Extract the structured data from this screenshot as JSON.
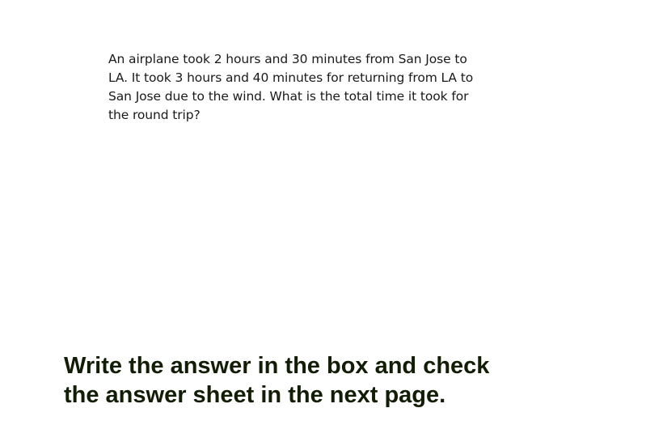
{
  "question": {
    "lines": [
      "An airplane took 2 hours and 30 minutes from  San Jose to",
      "LA. It took 3 hours and 40 minutes for returning from LA to",
      "San Jose due to the wind. What is the total time it took for",
      "the round trip?"
    ]
  },
  "instruction": {
    "lines": [
      "Write the answer in the box and check",
      "the answer sheet in the next page."
    ]
  },
  "colors": {
    "background": "#ffffff",
    "question_text": "#1a1a1a",
    "instruction_text": "#121d06"
  }
}
